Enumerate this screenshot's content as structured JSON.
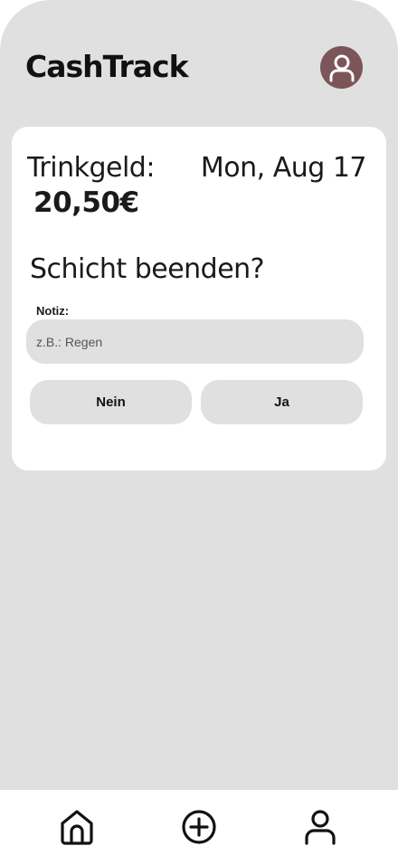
{
  "header": {
    "title": "CashTrack",
    "avatar_icon": "user-icon",
    "avatar_color": "#7b5558"
  },
  "card": {
    "tip_label": "Trinkgeld:",
    "date": "Mon, Aug 17",
    "tip_amount": "20,50€",
    "question": "Schicht beenden?",
    "note_label": "Notiz:",
    "note_placeholder": "z.B.: Regen",
    "note_value": "",
    "no_label": "Nein",
    "yes_label": "Ja"
  },
  "bottom_nav": {
    "items": [
      {
        "icon": "home-icon"
      },
      {
        "icon": "plus-circle-icon"
      },
      {
        "icon": "user-icon"
      }
    ]
  },
  "colors": {
    "background": "#e0e0e0",
    "card": "#ffffff",
    "avatar": "#7b5558"
  }
}
